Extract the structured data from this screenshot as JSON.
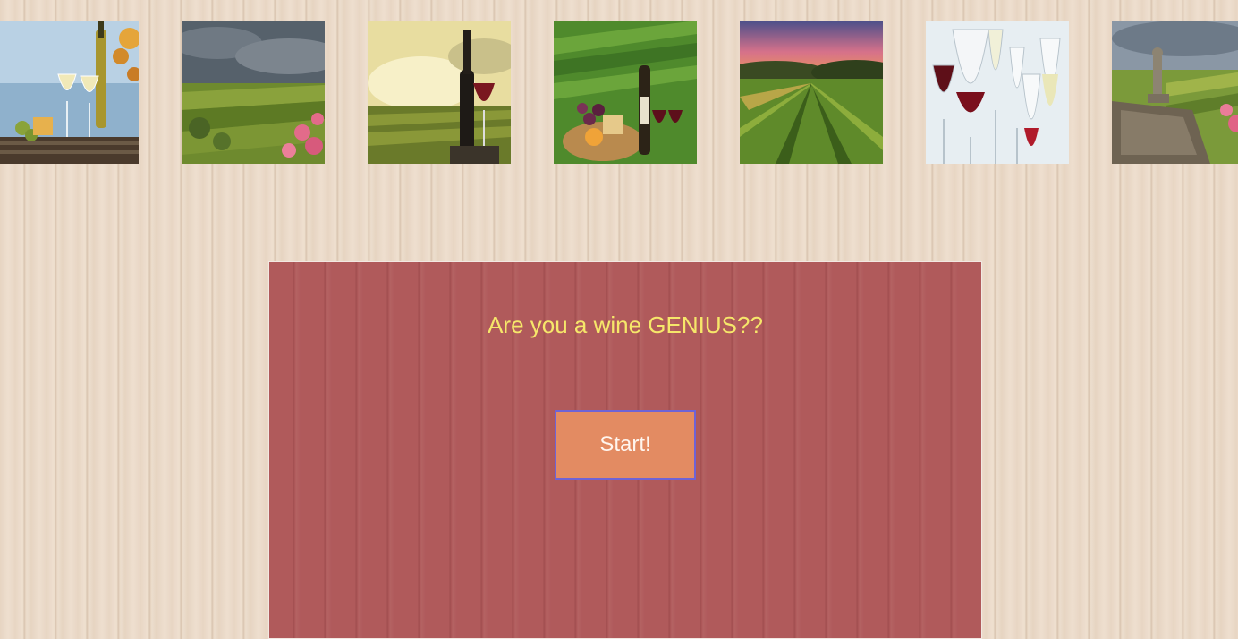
{
  "gallery": {
    "images": [
      {
        "name": "white-wine-glasses-lake-photo"
      },
      {
        "name": "stormy-vineyard-flowers-photo"
      },
      {
        "name": "red-wine-bottle-sunset-vineyard-photo"
      },
      {
        "name": "wine-cheese-vineyard-photo"
      },
      {
        "name": "sunset-vineyard-rows-photo"
      },
      {
        "name": "assorted-wine-glasses-photo"
      },
      {
        "name": "vineyard-statue-ruins-photo"
      }
    ]
  },
  "quiz": {
    "title": "Are you a wine GENIUS??",
    "start_label": "Start!"
  },
  "colors": {
    "panel_background": "#b05a5b",
    "title_text": "#f6e76a",
    "button_background": "#e38b62",
    "button_border": "#6e63d6"
  }
}
